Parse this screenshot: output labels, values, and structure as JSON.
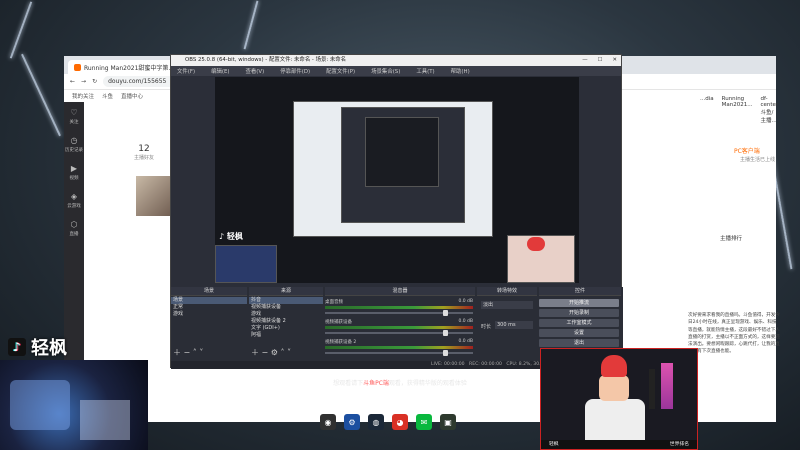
{
  "browser": {
    "tab_title": "Running Man2021甜蜜中字第...",
    "url": "douyu.com/155655",
    "bookmarks": [
      "我的关注",
      "斗鱼",
      "直播中心"
    ],
    "right_tabs": [
      "...dia",
      "Running Man2021...",
      "df-center 斗鱼/主播..."
    ],
    "followers": {
      "count": "12",
      "label": "主播好友"
    },
    "pc_live": "PC客户端",
    "pc_live_sub": "主播生活已上线",
    "anchor_rank": "主播排行",
    "mascot": "主播",
    "description": "次好要来求看我的直播吗。斗鱼值得，开发今日24小时在线，真正呈现游戏、娱乐、科技等直播，就能热情主播，这段最好不错过下人直播的打赏，主播以不正面方式的，这样要违法演出。要想闲暇跟踪，心跳代打，让我的直播，有下次直播也能。",
    "sidebar": [
      {
        "icon": "heart-icon",
        "label": "关注"
      },
      {
        "icon": "history-icon",
        "label": "历史记录"
      },
      {
        "icon": "video-icon",
        "label": "视频"
      },
      {
        "icon": "game-icon",
        "label": "云游戏"
      },
      {
        "icon": "shield-icon",
        "label": "直播"
      }
    ]
  },
  "obs": {
    "title": "OBS 25.0.8 (64-bit, windows) - 配置文件: 未命名 - 场景: 未命名",
    "menu": [
      "文件(F)",
      "编辑(E)",
      "查看(V)",
      "停靠部件(D)",
      "配置文件(P)",
      "场景集合(S)",
      "工具(T)",
      "帮助(H)"
    ],
    "panels": {
      "scenes": "场景",
      "sources": "来源",
      "mixer": "混音器",
      "transitions": "转场特效",
      "controls": "控件"
    },
    "scenes": [
      "场景",
      "正常",
      "游戏"
    ],
    "sources": [
      "抖音",
      "视频捕获设备",
      "游戏",
      "视频捕获设备 2",
      "文字 (GDI+)",
      "阿福"
    ],
    "mixer": [
      {
        "name": "桌面音频",
        "value": "0.0 dB"
      },
      {
        "name": "视频捕获设备",
        "value": "0.0 dB"
      },
      {
        "name": "视频捕获设备 2",
        "value": "0.0 dB"
      }
    ],
    "transition": {
      "type": "淡出",
      "duration_label": "时长",
      "duration": "300 ms"
    },
    "controls": [
      "开始推流",
      "开始录制",
      "工作室模式",
      "设置",
      "退出"
    ],
    "status": {
      "live": "LIVE: 00:00:00",
      "rec": "REC: 00:00:00",
      "cpu": "CPU: 8.2%, 30.00 fps"
    }
  },
  "overlay": {
    "logo": "轻枫",
    "subtitle_prefix": "想观看请下",
    "subtitle_highlight": "斗鱼PC端",
    "subtitle_suffix": "观看，获得精华版的观看体验",
    "cam_band_left": "轻枫",
    "cam_band_right": "世界排名",
    "taskbar": [
      {
        "icon": "obs-icon",
        "color": "#303030",
        "glyph": "◉"
      },
      {
        "icon": "settings-icon",
        "color": "#1c4fa0",
        "glyph": "⚙"
      },
      {
        "icon": "steam-icon",
        "color": "#1b2838",
        "glyph": "◍"
      },
      {
        "icon": "chrome-icon",
        "color": "#d93025",
        "glyph": "◕"
      },
      {
        "icon": "wechat-icon",
        "color": "#09b83e",
        "glyph": "✉"
      },
      {
        "icon": "game-icon",
        "color": "#2e3a2e",
        "glyph": "▣"
      }
    ]
  }
}
